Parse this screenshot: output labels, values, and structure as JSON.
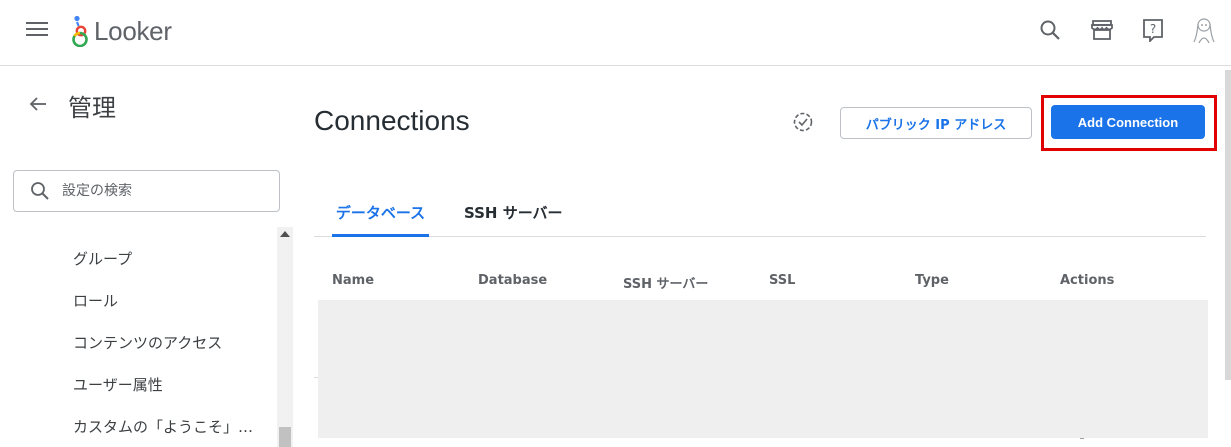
{
  "app": {
    "name": "Looker",
    "brand_color": "#1a73e8",
    "highlight_color": "#e00000"
  },
  "topbar": {
    "menu_icon": "hamburger-menu-icon",
    "icons": [
      "search-icon",
      "marketplace-icon",
      "help-icon",
      "user-avatar"
    ]
  },
  "sidebar": {
    "title": "管理",
    "search_placeholder": "設定の検索",
    "items": [
      {
        "label": "グループ"
      },
      {
        "label": "ロール"
      },
      {
        "label": "コンテンツのアクセス"
      },
      {
        "label": "ユーザー属性"
      },
      {
        "label": "カスタムの「ようこそ」…"
      }
    ]
  },
  "main": {
    "title": "Connections",
    "public_ip_button": "パブリック IP アドレス",
    "add_connection_button": "Add Connection",
    "tabs": [
      {
        "label": "データベース",
        "active": true
      },
      {
        "label": "SSH サーバー",
        "active": false
      }
    ],
    "table": {
      "columns": [
        "Name",
        "Database",
        "SSH サーバー",
        "SSL",
        "Type",
        "Actions"
      ],
      "rows": []
    }
  }
}
